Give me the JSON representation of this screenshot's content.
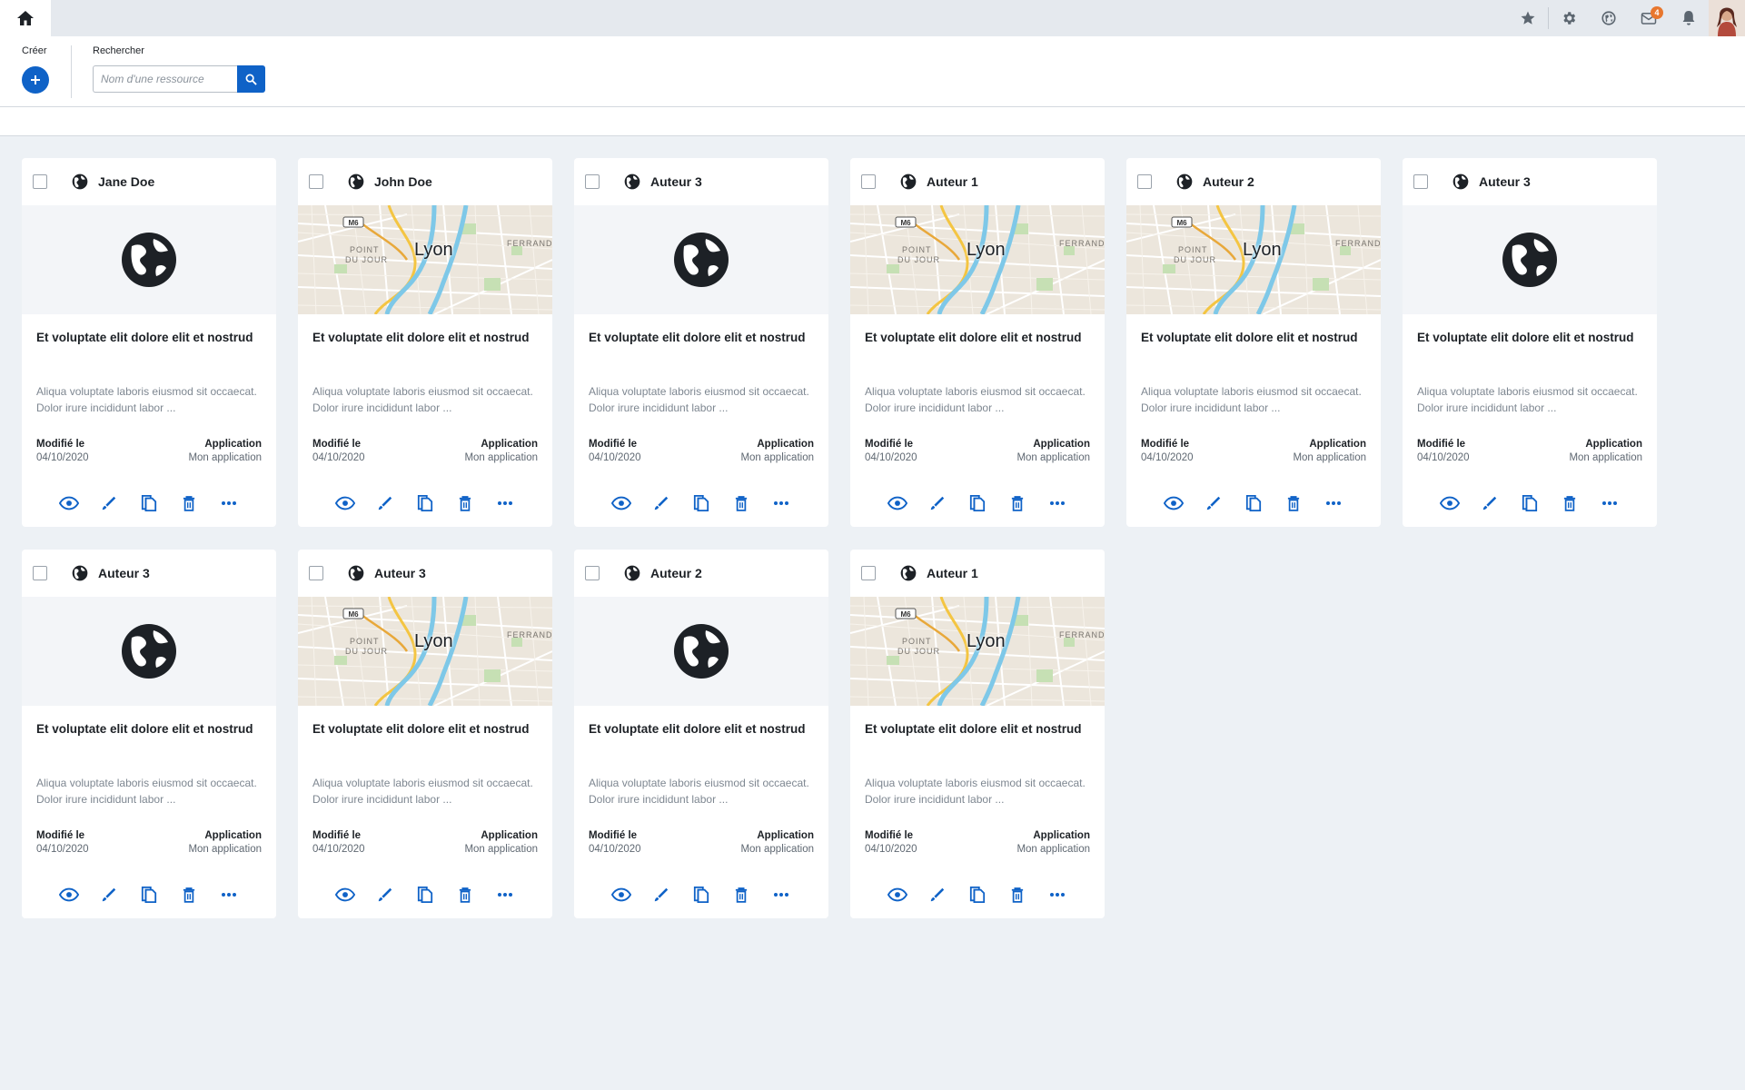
{
  "toolbar": {
    "create_label": "Créer",
    "search_label": "Rechercher",
    "search_placeholder": "Nom d'une ressource"
  },
  "topbar": {
    "icons": [
      "home-icon",
      "star-icon",
      "gear-icon",
      "globe-icon",
      "mail-icon",
      "bell-icon",
      "avatar"
    ],
    "mail_badge": "4"
  },
  "colors": {
    "accent": "#0f62c7",
    "badge": "#e8772e",
    "background": "#edf1f5"
  },
  "cards": [
    {
      "author": "Jane Doe",
      "image": "globe",
      "title": "Et voluptate elit dolore elit et nostrud",
      "description": "Aliqua voluptate laboris eiusmod sit occaecat. Dolor irure incididunt labor ...",
      "modified_label": "Modifié le",
      "modified_date": "04/10/2020",
      "app_label": "Application",
      "app_name": "Mon application"
    },
    {
      "author": "John Doe",
      "image": "map",
      "map_text": "Lyon",
      "title": "Et voluptate elit dolore elit et nostrud",
      "description": "Aliqua voluptate laboris eiusmod sit occaecat. Dolor irure incididunt labor ...",
      "modified_label": "Modifié le",
      "modified_date": "04/10/2020",
      "app_label": "Application",
      "app_name": "Mon application"
    },
    {
      "author": "Auteur 3",
      "image": "globe",
      "title": "Et voluptate elit dolore elit et nostrud",
      "description": "Aliqua voluptate laboris eiusmod sit occaecat. Dolor irure incididunt labor ...",
      "modified_label": "Modifié le",
      "modified_date": "04/10/2020",
      "app_label": "Application",
      "app_name": "Mon application"
    },
    {
      "author": "Auteur 1",
      "image": "map",
      "map_text": "Lyon",
      "title": "Et voluptate elit dolore elit et nostrud",
      "description": "Aliqua voluptate laboris eiusmod sit occaecat. Dolor irure incididunt labor ...",
      "modified_label": "Modifié le",
      "modified_date": "04/10/2020",
      "app_label": "Application",
      "app_name": "Mon application"
    },
    {
      "author": "Auteur 2",
      "image": "map",
      "map_text": "Lyon",
      "title": "Et voluptate elit dolore elit et nostrud",
      "description": "Aliqua voluptate laboris eiusmod sit occaecat. Dolor irure incididunt labor ...",
      "modified_label": "Modifié le",
      "modified_date": "04/10/2020",
      "app_label": "Application",
      "app_name": "Mon application"
    },
    {
      "author": "Auteur 3",
      "image": "globe",
      "title": "Et voluptate elit dolore elit et nostrud",
      "description": "Aliqua voluptate laboris eiusmod sit occaecat. Dolor irure incididunt labor ...",
      "modified_label": "Modifié le",
      "modified_date": "04/10/2020",
      "app_label": "Application",
      "app_name": "Mon application"
    },
    {
      "author": "Auteur 3",
      "image": "globe",
      "title": "Et voluptate elit dolore elit et nostrud",
      "description": "Aliqua voluptate laboris eiusmod sit occaecat. Dolor irure incididunt labor ...",
      "modified_label": "Modifié le",
      "modified_date": "04/10/2020",
      "app_label": "Application",
      "app_name": "Mon application"
    },
    {
      "author": "Auteur 3",
      "image": "map",
      "map_text": "Lyon",
      "title": "Et voluptate elit dolore elit et nostrud",
      "description": "Aliqua voluptate laboris eiusmod sit occaecat. Dolor irure incididunt labor ...",
      "modified_label": "Modifié le",
      "modified_date": "04/10/2020",
      "app_label": "Application",
      "app_name": "Mon application"
    },
    {
      "author": "Auteur 2",
      "image": "globe",
      "title": "Et voluptate elit dolore elit et nostrud",
      "description": "Aliqua voluptate laboris eiusmod sit occaecat. Dolor irure incididunt labor ...",
      "modified_label": "Modifié le",
      "modified_date": "04/10/2020",
      "app_label": "Application",
      "app_name": "Mon application"
    },
    {
      "author": "Auteur 1",
      "image": "map",
      "map_text": "Lyon",
      "title": "Et voluptate elit dolore elit et nostrud",
      "description": "Aliqua voluptate laboris eiusmod sit occaecat. Dolor irure incididunt labor ...",
      "modified_label": "Modifié le",
      "modified_date": "04/10/2020",
      "app_label": "Application",
      "app_name": "Mon application"
    }
  ],
  "card_actions": [
    "eye-icon",
    "edit-icon",
    "copy-icon",
    "delete-icon",
    "more-icon"
  ]
}
